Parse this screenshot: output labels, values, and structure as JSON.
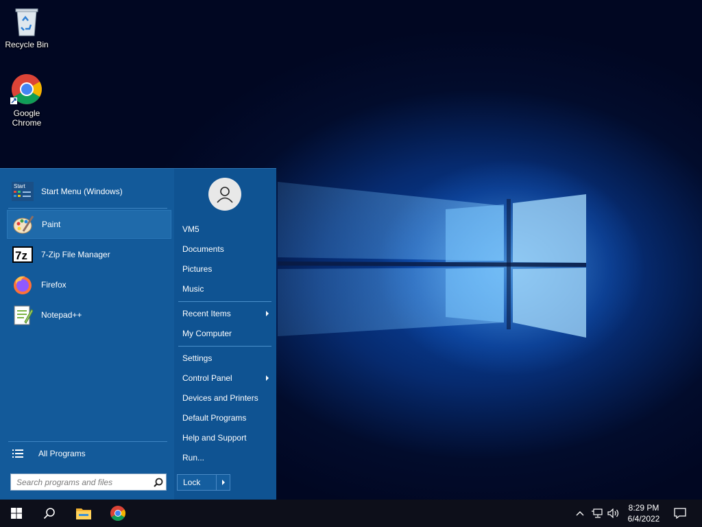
{
  "desktop": {
    "icons": [
      {
        "label": "Recycle Bin",
        "icon": "recycle-bin-icon"
      },
      {
        "label": "Google\nChrome",
        "icon": "chrome-icon"
      }
    ]
  },
  "start_menu": {
    "pinned": [
      {
        "label": "Start Menu (Windows)",
        "icon": "start-menu-icon"
      }
    ],
    "recent_programs": [
      {
        "label": "Paint",
        "icon": "paint-icon",
        "selected": true
      },
      {
        "label": "7-Zip File Manager",
        "icon": "7zip-icon"
      },
      {
        "label": "Firefox",
        "icon": "firefox-icon"
      },
      {
        "label": "Notepad++",
        "icon": "notepadpp-icon"
      }
    ],
    "all_programs_label": "All Programs",
    "search_placeholder": "Search programs and files",
    "right_items": [
      {
        "label": "VM5"
      },
      {
        "label": "Documents"
      },
      {
        "label": "Pictures"
      },
      {
        "label": "Music"
      },
      {
        "label": "Recent Items",
        "submenu": true
      },
      {
        "label": "My Computer"
      },
      {
        "label": "Settings"
      },
      {
        "label": "Control Panel",
        "submenu": true
      },
      {
        "label": "Devices and Printers"
      },
      {
        "label": "Default Programs"
      },
      {
        "label": "Help and Support"
      },
      {
        "label": "Run..."
      }
    ],
    "lock_label": "Lock"
  },
  "taskbar": {
    "buttons": [
      "windows-start-icon",
      "search-icon",
      "file-explorer-icon",
      "chrome-icon"
    ],
    "tray_icons": [
      "chevron-up-icon",
      "network-icon",
      "volume-icon"
    ],
    "time": "8:29 PM",
    "date": "6/4/2022",
    "notification_icon": "action-center-icon"
  },
  "colors": {
    "start_menu_bg": "#135a9a",
    "right_pane_bg": "#0f5392",
    "taskbar_bg": "#0d0f1a",
    "selected_item": "#1f6aaa"
  }
}
